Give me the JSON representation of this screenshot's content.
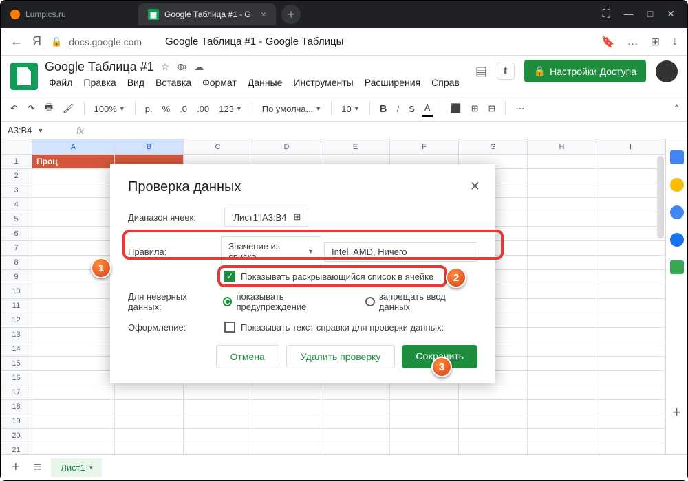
{
  "titlebar": {
    "tab1": "Lumpics.ru",
    "tab2": "Google Таблица #1 - G",
    "close": "×",
    "plus": "+"
  },
  "win": {
    "screenshot": "⛶",
    "min": "—",
    "max": "□",
    "close": "✕"
  },
  "addr": {
    "back": "←",
    "ya": "Я",
    "lock": "🔒",
    "url": "docs.google.com",
    "title": "Google Таблица #1 - Google Таблицы",
    "bookmark": "🔖",
    "more": "…",
    "ext": "⊞",
    "dl": "↓"
  },
  "sheets": {
    "title": "Google Таблица #1",
    "star": "☆",
    "move": "⟴",
    "cloud": "☁"
  },
  "menu": {
    "file": "Файл",
    "edit": "Правка",
    "view": "Вид",
    "insert": "Вставка",
    "format": "Формат",
    "data": "Данные",
    "tools": "Инструменты",
    "ext": "Расширения",
    "help": "Справ"
  },
  "hdr_right": {
    "comment": "▤",
    "present": "⬆",
    "share": "Настройки Доступа",
    "lock": "🔒"
  },
  "toolbar": {
    "undo": "↶",
    "redo": "↷",
    "print": "🖶",
    "paint": "🖌",
    "zoom": "100%",
    "rub": "р.",
    "pct": "%",
    "dec0": ".0",
    "dec00": ".00",
    "num": "123",
    "font": "По умолча...",
    "size": "10",
    "bold": "B",
    "italic": "I",
    "strike": "S",
    "color": "A",
    "fill": "⬛",
    "border": "⊞",
    "merge": "⊟",
    "more": "⋯",
    "chev": "⌃"
  },
  "namebox": {
    "ref": "A3:B4",
    "fx": "fx"
  },
  "cols": [
    "A",
    "B",
    "C",
    "D",
    "E",
    "F",
    "G",
    "H",
    "I"
  ],
  "rows": [
    "1",
    "2",
    "3",
    "4",
    "5",
    "6",
    "7",
    "8",
    "9",
    "10",
    "11",
    "12",
    "13",
    "14",
    "15",
    "16",
    "17",
    "18",
    "19",
    "20",
    "21"
  ],
  "header_cell": "Проц",
  "dialog": {
    "title": "Проверка данных",
    "close": "✕",
    "range_lbl": "Диапазон ячеек:",
    "range_val": "'Лист1'!A3:B4",
    "rules_lbl": "Правила:",
    "rules_sel": "Значение из списка",
    "rules_val": "Intel, AMD, Ничего",
    "show_dd": "Показывать раскрывающийся список в ячейке",
    "invalid_lbl": "Для неверных данных:",
    "inv_warn": "показывать предупреждение",
    "inv_reject": "запрещать ввод данных",
    "appearance_lbl": "Оформление:",
    "help_text": "Показывать текст справки для проверки данных:",
    "cancel": "Отмена",
    "remove": "Удалить проверку",
    "save": "Сохранить"
  },
  "callouts": {
    "c1": "1",
    "c2": "2",
    "c3": "3"
  },
  "bottom": {
    "plus": "+",
    "menu": "≡",
    "sheet": "Лист1",
    "caret": "▾"
  },
  "side_colors": [
    "#4285f4",
    "#fbbc04",
    "#4285f4",
    "#34a853",
    "#ea4335",
    "#34a853"
  ]
}
